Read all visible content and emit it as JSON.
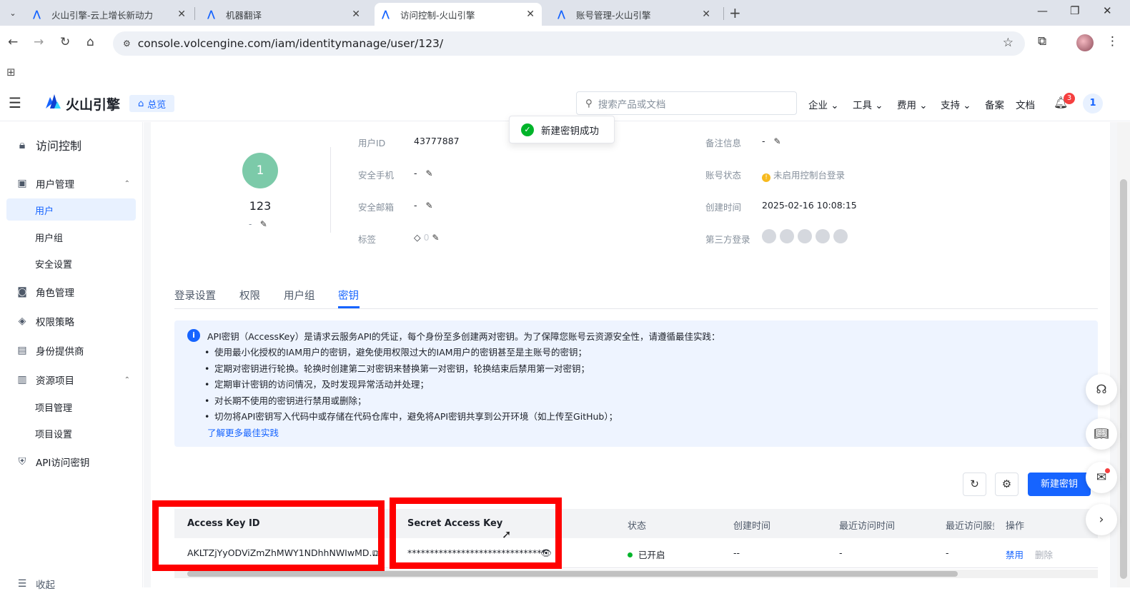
{
  "browser": {
    "tabs": [
      {
        "title": "火山引擎-云上增长新动力",
        "active": false
      },
      {
        "title": "机器翻译",
        "active": false
      },
      {
        "title": "访问控制-火山引擎",
        "active": true
      },
      {
        "title": "账号管理-火山引擎",
        "active": false
      }
    ],
    "url": "console.volcengine.com/iam/identitymanage/user/123/"
  },
  "header": {
    "brand": "火山引擎",
    "overview": "总览",
    "search_placeholder": "搜索产品或文档",
    "nav": [
      "企业",
      "工具",
      "费用",
      "支持",
      "备案",
      "文档"
    ],
    "notifications": "3",
    "account_initial": "1"
  },
  "sidebar": {
    "title": "访问控制",
    "items": [
      {
        "label": "用户管理",
        "icon": "user-manage-icon"
      },
      {
        "label": "用户"
      },
      {
        "label": "用户组"
      },
      {
        "label": "安全设置"
      },
      {
        "label": "角色管理",
        "icon": "role-icon"
      },
      {
        "label": "权限策略",
        "icon": "policy-icon"
      },
      {
        "label": "身份提供商",
        "icon": "idp-icon"
      },
      {
        "label": "资源项目",
        "icon": "project-icon"
      },
      {
        "label": "项目管理"
      },
      {
        "label": "项目设置"
      },
      {
        "label": "API访问密钥",
        "icon": "shield-icon"
      }
    ],
    "collapse": "收起"
  },
  "toast": "新建密钥成功",
  "user": {
    "avatar_initial": "1",
    "name": "123",
    "desc": "-",
    "fields": {
      "user_id_label": "用户ID",
      "user_id": "43777887",
      "phone_label": "安全手机",
      "phone": "-",
      "email_label": "安全邮箱",
      "email": "-",
      "tag_label": "标签",
      "tag_count": "0",
      "remark_label": "备注信息",
      "remark": "-",
      "status_label": "账号状态",
      "status": "未启用控制台登录",
      "created_label": "创建时间",
      "created": "2025-02-16 10:08:15",
      "third_party_label": "第三方登录"
    }
  },
  "tabs": [
    "登录设置",
    "权限",
    "用户组",
    "密钥"
  ],
  "notice": {
    "intro": "API密钥（AccessKey）是请求云服务API的凭证，每个身份至多创建两对密钥。为了保障您账号云资源安全性，请遵循最佳实践：",
    "items": [
      "使用最小化授权的IAM用户的密钥，避免使用权限过大的IAM用户的密钥甚至是主账号的密钥；",
      "定期对密钥进行轮换。轮换时创建第二对密钥来替换第一对密钥，轮换结束后禁用第一对密钥；",
      "定期审计密钥的访问情况，及时发现异常活动并处理；",
      "对长期不使用的密钥进行禁用或删除；",
      "切勿将API密钥写入代码中或存储在代码仓库中，避免将API密钥共享到公开环境（如上传至GitHub）；"
    ],
    "more": "了解更多最佳实践"
  },
  "actions": {
    "create_key": "新建密钥"
  },
  "table": {
    "headers": [
      "Access Key ID",
      "Secret Access Key",
      "状态",
      "创建时间",
      "最近访问时间",
      "最近访问服务",
      "操作"
    ],
    "row": {
      "access_key_id": "AKLTZjYyODViZmZhMWY1NDhhNWIwMD...",
      "secret": "*******************************",
      "status": "已开启",
      "created": "--",
      "last_access": "-",
      "last_service": "-",
      "disable": "禁用",
      "delete": "删除"
    }
  },
  "colors": {
    "accent": "#1664ff",
    "success": "#00b42a",
    "highlight": "#ff0000"
  }
}
